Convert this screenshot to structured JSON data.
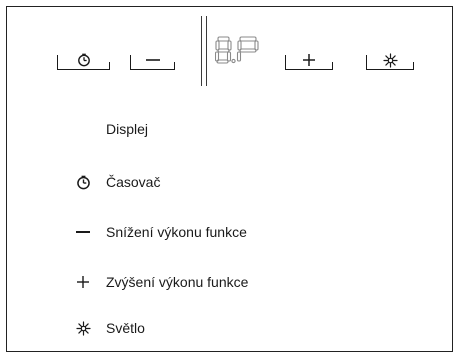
{
  "panel": {
    "buttons": [
      {
        "id": "timer",
        "icon": "timer-icon"
      },
      {
        "id": "minus",
        "icon": "minus-icon"
      },
      {
        "id": "plus",
        "icon": "plus-icon"
      },
      {
        "id": "light",
        "icon": "light-icon"
      }
    ],
    "display": {
      "icon": "seven-segment-display"
    }
  },
  "legend": {
    "display_label": "Displej",
    "timer_label": "Časovač",
    "minus_label": "Snížení výkonu funkce",
    "plus_label": "Zvýšení výkonu funkce",
    "light_label": "Světlo"
  },
  "colors": {
    "ink": "#1a1a1a",
    "segment": "#8a8a8a",
    "background": "#ffffff"
  }
}
